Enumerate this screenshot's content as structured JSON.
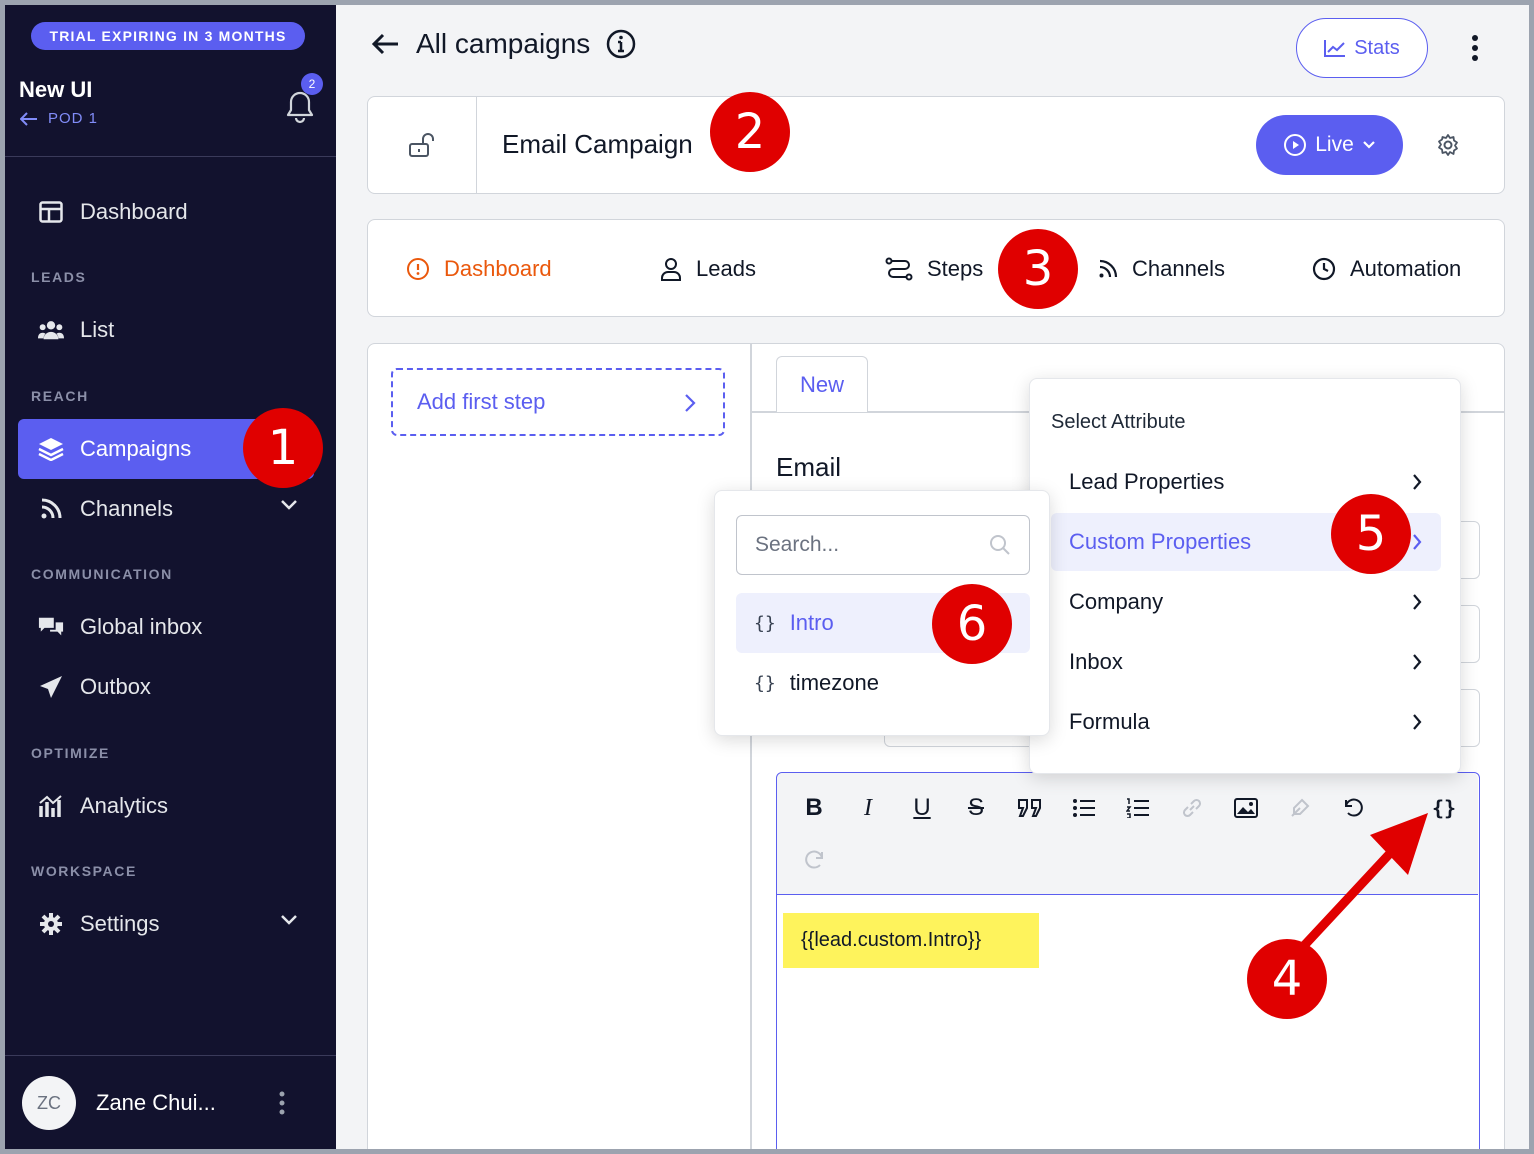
{
  "sidebar": {
    "trial_banner": "TRIAL EXPIRING IN 3 MONTHS",
    "workspace_name": "New UI",
    "workspace_sub": "POD 1",
    "notification_count": "2",
    "dashboard": "Dashboard",
    "section_leads": "LEADS",
    "list": "List",
    "section_reach": "REACH",
    "campaigns": "Campaigns",
    "channels": "Channels",
    "section_communication": "COMMUNICATION",
    "global_inbox": "Global inbox",
    "outbox": "Outbox",
    "section_optimize": "OPTIMIZE",
    "analytics": "Analytics",
    "section_workspace": "WORKSPACE",
    "settings": "Settings",
    "user_initials": "ZC",
    "user_name": "Zane Chui..."
  },
  "header": {
    "title": "All campaigns",
    "stats_label": "Stats"
  },
  "campaign": {
    "name": "Email Campaign",
    "status_label": "Live"
  },
  "tabs": {
    "dashboard": "Dashboard",
    "leads": "Leads",
    "steps": "Steps",
    "channels": "Channels",
    "automation": "Automation"
  },
  "steps": {
    "add_first": "Add first step",
    "tab_new": "New",
    "email_label": "Email"
  },
  "editor": {
    "content": "{{lead.custom.Intro}}"
  },
  "attribute_menu": {
    "title": "Select Attribute",
    "items": [
      "Lead Properties",
      "Custom Properties",
      "Company",
      "Inbox",
      "Formula"
    ]
  },
  "search_menu": {
    "placeholder": "Search...",
    "items": [
      "Intro",
      "timezone"
    ]
  },
  "annotations": [
    "1",
    "2",
    "3",
    "4",
    "5",
    "6"
  ],
  "colors": {
    "sidebar_bg": "#12122e",
    "accent": "#5b5ef0",
    "active_tab": "#ea580c",
    "highlight": "#fef35c",
    "annotation": "#e00000"
  }
}
